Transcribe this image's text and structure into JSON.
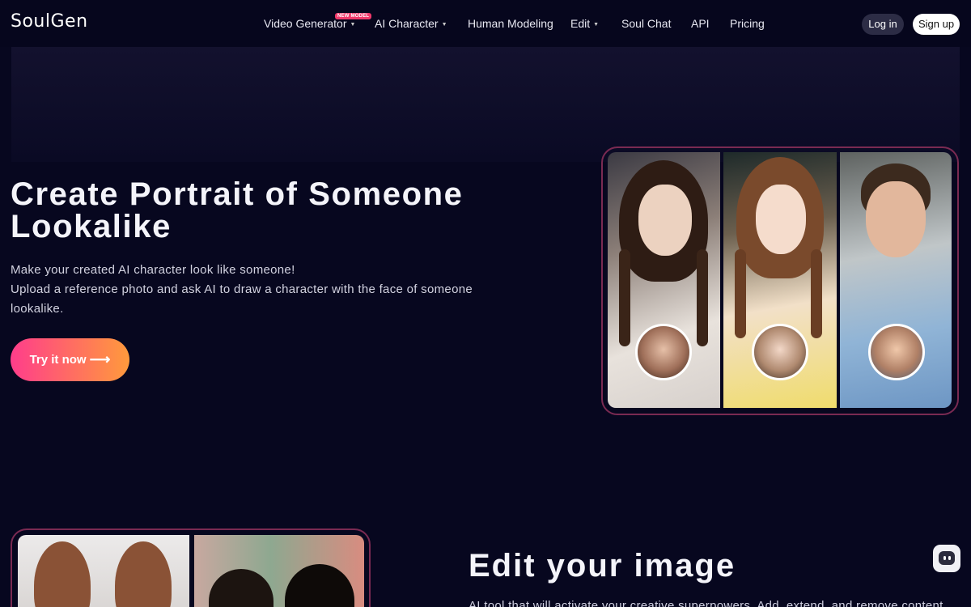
{
  "brand": {
    "logo": "SoulGen"
  },
  "nav": {
    "items": [
      {
        "label": "Video Generator",
        "has_caret": true
      },
      {
        "label": "AI Character",
        "has_caret": true
      },
      {
        "label": "Human Modeling",
        "has_caret": false
      },
      {
        "label": "Edit",
        "has_caret": true
      },
      {
        "label": "Soul Chat",
        "has_caret": false
      },
      {
        "label": "API",
        "has_caret": false
      },
      {
        "label": "Pricing",
        "has_caret": false
      }
    ],
    "new_badge": "NEW MODEL",
    "login": "Log in",
    "signup": "Sign up"
  },
  "hero": {
    "title": "Create Portrait of Someone Lookalike",
    "subtitle_line1": "Make your created AI character look like someone!",
    "subtitle_line2": "Upload a reference photo and ask AI to draw a character with the face of someone lookalike.",
    "cta": "Try it now",
    "cta_icon": "arrow-right-icon"
  },
  "section2": {
    "title": "Edit your image",
    "subtitle": "AI tool that will activate your creative superpowers. Add, extend, and remove content"
  },
  "icons": {
    "chat": "chat-bot-icon"
  },
  "colors": {
    "background": "#07071f",
    "cta_start": "#ff3d8b",
    "cta_end": "#ff9a3c",
    "badge": "#f0396b",
    "frame_border": "#7a2a52"
  }
}
